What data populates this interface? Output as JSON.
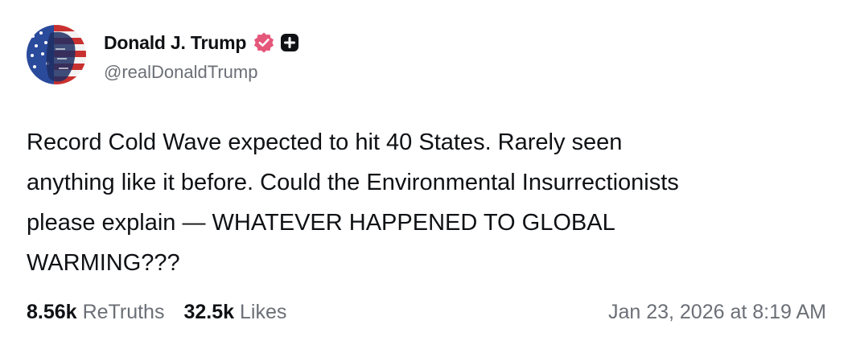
{
  "author": {
    "display_name": "Donald J. Trump",
    "handle": "@realDonaldTrump",
    "badges": [
      "verified-badge-icon",
      "plus-badge-icon"
    ],
    "verified_color": "#e5577a"
  },
  "post": {
    "lines": [
      "Record Cold Wave expected to hit 40 States. Rarely seen",
      "anything like it before. Could the Environmental Insurrectionists",
      "please explain — WHATEVER HAPPENED TO GLOBAL",
      "WARMING???"
    ]
  },
  "stats": {
    "retruths_count": "8.56k",
    "retruths_label": "ReTruths",
    "likes_count": "32.5k",
    "likes_label": "Likes"
  },
  "timestamp": "Jan 23, 2026 at 8:19 AM"
}
